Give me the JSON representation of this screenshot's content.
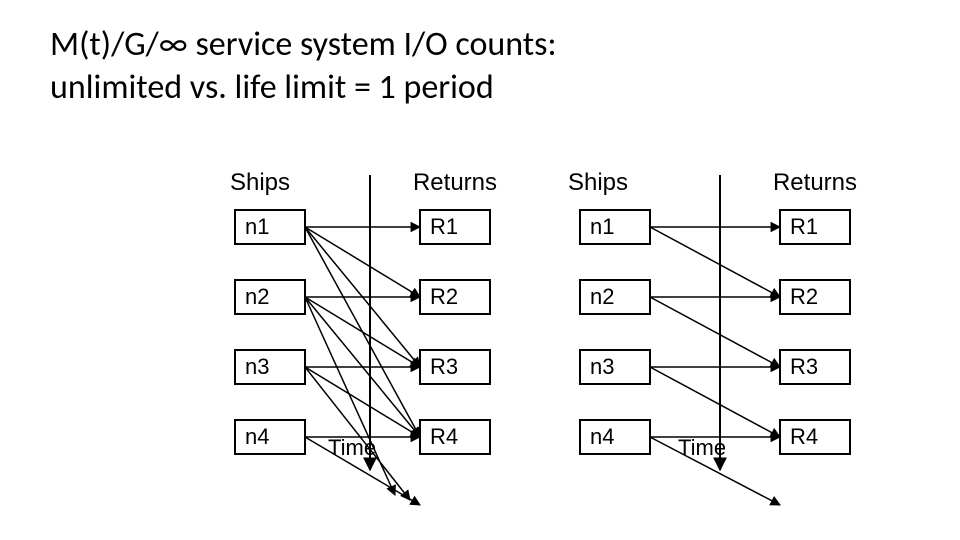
{
  "title_line1": "M(t)/G/∞ service system I/O counts:",
  "title_line2": "unlimited vs. life limit = 1 period",
  "headers": {
    "ships": "Ships",
    "returns": "Returns"
  },
  "left": {
    "ships": [
      "n1",
      "n2",
      "n3",
      "n4"
    ],
    "returns": [
      "R1",
      "R2",
      "R3",
      "R4"
    ],
    "time_label": "Time"
  },
  "right": {
    "ships": [
      "n1",
      "n2",
      "n3",
      "n4"
    ],
    "returns": [
      "R1",
      "R2",
      "R3",
      "R4"
    ],
    "time_label": "Time"
  },
  "chart_data": {
    "type": "diagram",
    "description": "Two side-by-side bipartite mappings from ship-period boxes n1..n4 to return-period boxes R1..R4 along a downward Time axis.",
    "left_panel": {
      "label": "unlimited",
      "ships": [
        "n1",
        "n2",
        "n3",
        "n4"
      ],
      "returns": [
        "R1",
        "R2",
        "R3",
        "R4"
      ],
      "arrows": [
        {
          "from": "n1",
          "to": "R1"
        },
        {
          "from": "n1",
          "to": "R2"
        },
        {
          "from": "n1",
          "to": "R3"
        },
        {
          "from": "n1",
          "to": "R4"
        },
        {
          "from": "n2",
          "to": "R2"
        },
        {
          "from": "n2",
          "to": "R3"
        },
        {
          "from": "n2",
          "to": "R4"
        },
        {
          "from": "n3",
          "to": "R3"
        },
        {
          "from": "n3",
          "to": "R4"
        },
        {
          "from": "n4",
          "to": "R4"
        }
      ],
      "overflow_arrows_from": [
        "n2",
        "n3",
        "n4"
      ]
    },
    "right_panel": {
      "label": "life limit = 1 period",
      "ships": [
        "n1",
        "n2",
        "n3",
        "n4"
      ],
      "returns": [
        "R1",
        "R2",
        "R3",
        "R4"
      ],
      "arrows": [
        {
          "from": "n1",
          "to": "R1"
        },
        {
          "from": "n1",
          "to": "R2"
        },
        {
          "from": "n2",
          "to": "R2"
        },
        {
          "from": "n2",
          "to": "R3"
        },
        {
          "from": "n3",
          "to": "R3"
        },
        {
          "from": "n3",
          "to": "R4"
        },
        {
          "from": "n4",
          "to": "R4"
        }
      ],
      "overflow_arrows_from": [
        "n4"
      ]
    }
  }
}
